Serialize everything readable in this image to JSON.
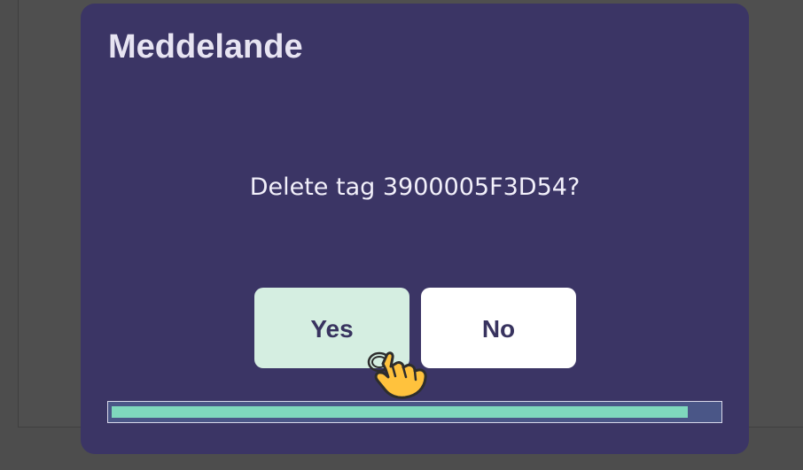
{
  "dialog": {
    "title": "Meddelande",
    "message": "Delete tag 3900005F3D54?",
    "buttons": {
      "yes": "Yes",
      "no": "No"
    },
    "progress": 0.95
  },
  "cursor": {
    "icon": "hand-pointer-icon"
  },
  "colors": {
    "backdrop": "#4d4d4d",
    "dialog": "#3b3565",
    "yes_button": "#d5eee1",
    "no_button": "#ffffff",
    "progress_fill": "#7fd8bd",
    "cursor": "#ffc23d"
  }
}
